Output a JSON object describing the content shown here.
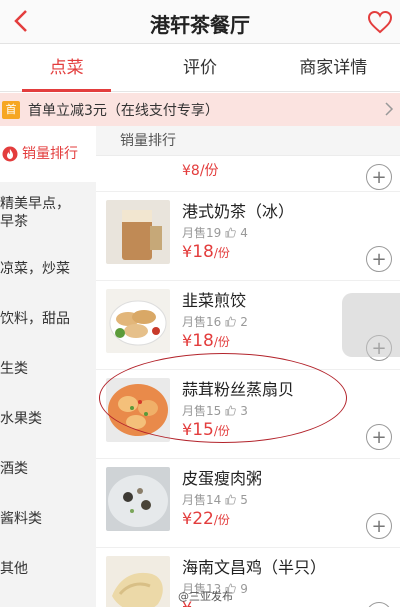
{
  "header": {
    "title": "港轩茶餐厅",
    "back_icon": "chevron-left-icon",
    "favorite_icon": "heart-icon",
    "accent": "#e33d3d"
  },
  "tabs": [
    {
      "label": "点菜",
      "active": true
    },
    {
      "label": "评价",
      "active": false
    },
    {
      "label": "商家详情",
      "active": false
    }
  ],
  "promo": {
    "tag": "首",
    "text": "首单立减3元（在线支付专享）"
  },
  "sidebar": {
    "items": [
      {
        "label": "销量排行",
        "active": true,
        "icon": "fire-icon"
      },
      {
        "label": "精美早点，早茶"
      },
      {
        "label": "凉菜，炒菜"
      },
      {
        "label": "饮料，甜品"
      },
      {
        "label": "生类"
      },
      {
        "label": "水果类"
      },
      {
        "label": "酒类"
      },
      {
        "label": "酱料类"
      },
      {
        "label": "其他"
      }
    ]
  },
  "main": {
    "section_title": "销量排行",
    "partial_item": {
      "price": "¥8/份"
    },
    "items": [
      {
        "name": "港式奶茶（冰）",
        "sold": "月售19",
        "likes": "4",
        "yen": "¥",
        "amount": "18",
        "unit": "/份"
      },
      {
        "name": "韭菜煎饺",
        "sold": "月售16",
        "likes": "2",
        "yen": "¥",
        "amount": "18",
        "unit": "/份"
      },
      {
        "name": "蒜茸粉丝蒸扇贝",
        "sold": "月售15",
        "likes": "3",
        "yen": "¥",
        "amount": "15",
        "unit": "/份"
      },
      {
        "name": "皮蛋瘦肉粥",
        "sold": "月售14",
        "likes": "5",
        "yen": "¥",
        "amount": "22",
        "unit": "/份"
      },
      {
        "name": "海南文昌鸡（半只）",
        "sold": "月售13",
        "likes": "9",
        "yen": "¥",
        "amount": "",
        "unit": ""
      }
    ]
  },
  "watermark": "@三亚发布"
}
